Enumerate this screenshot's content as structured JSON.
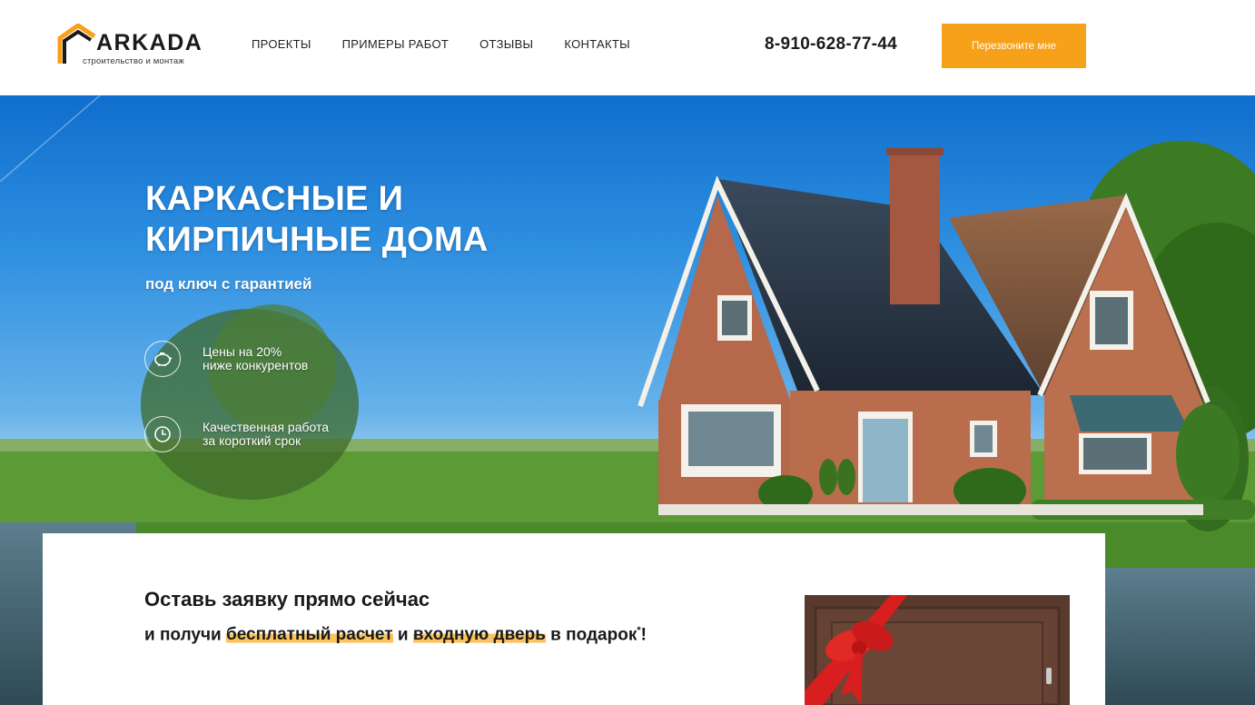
{
  "header": {
    "logo": {
      "name": "ARKADA",
      "tagline": "строительство и монтаж"
    },
    "nav": [
      "ПРОЕКТЫ",
      "ПРИМЕРЫ РАБОТ",
      "ОТЗЫВЫ",
      "КОНТАКТЫ"
    ],
    "phone": "8-910-628-77-44",
    "callback_label": "Перезвоните мне"
  },
  "hero": {
    "title_line1": "КАРКАСНЫЕ И",
    "title_line2": "КИРПИЧНЫЕ ДОМА",
    "subtitle": "под ключ с гарантией",
    "features": [
      {
        "icon": "piggy-bank-icon",
        "line1": "Цены на 20%",
        "line2": "ниже конкурентов"
      },
      {
        "icon": "clock-icon",
        "line1": "Качественная работа",
        "line2": "за короткий срок"
      }
    ]
  },
  "offer": {
    "title": "Оставь заявку прямо сейчас",
    "sub_before": "и получи ",
    "highlight1": "бесплатный расчет",
    "sub_middle": " и ",
    "highlight2": "входную дверь",
    "sub_after": " в подарок",
    "asterisk": "*",
    "exclamation": "!"
  },
  "colors": {
    "accent": "#f7a11a",
    "highlight": "#fbc35a",
    "text": "#1a1a1a"
  }
}
